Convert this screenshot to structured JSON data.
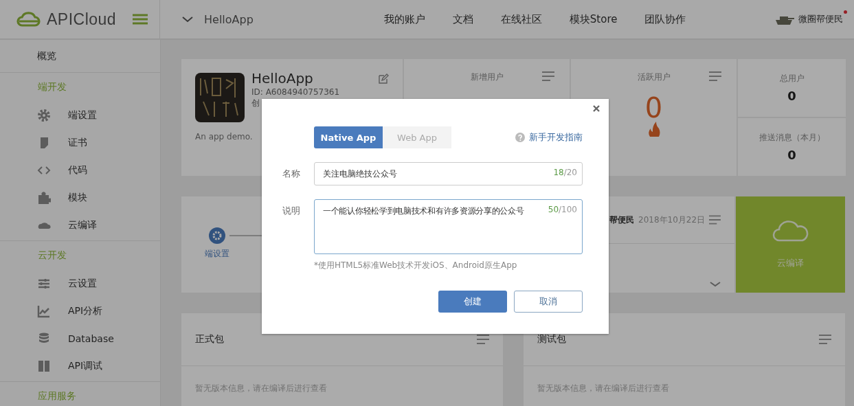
{
  "brand": {
    "name": "APICloud"
  },
  "topbar": {
    "app": "HelloApp",
    "nav": [
      "我的账户",
      "文档",
      "在线社区",
      "模块Store",
      "团队协作"
    ],
    "user": "微圈帮便民",
    "notification": true
  },
  "sidebar": {
    "overview": {
      "label": "概览",
      "selected": false
    },
    "sections": [
      {
        "title": "端开发",
        "items": [
          {
            "label": "端设置",
            "selected": false
          },
          {
            "label": "证书",
            "selected": false
          },
          {
            "label": "代码",
            "selected": false
          },
          {
            "label": "模块",
            "selected": false
          },
          {
            "label": "云编译",
            "selected": false
          }
        ]
      },
      {
        "title": "云开发",
        "items": [
          {
            "label": "云设置",
            "selected": false
          },
          {
            "label": "API分析",
            "selected": false
          },
          {
            "label": "Database",
            "selected": false
          },
          {
            "label": "API调试",
            "selected": false
          }
        ]
      },
      {
        "title": "应用服务"
      }
    ]
  },
  "app_card": {
    "name": "HelloApp",
    "id": "ID: A6084940757361",
    "created": "创",
    "description": "An app demo."
  },
  "stats": [
    {
      "title": "新增用户"
    },
    {
      "title": "活跃用户",
      "value": "0"
    }
  ],
  "totals": [
    {
      "title": "总用户",
      "value": "0"
    },
    {
      "title": "推送消息（本月）",
      "value": "0"
    }
  ],
  "steps": [
    {
      "label": "端设置"
    }
  ],
  "activity": {
    "user": "帮便民",
    "date": "2018年10月22日"
  },
  "compile_tile": {
    "label": "云编译"
  },
  "packages": [
    {
      "title": "正式包",
      "empty": "暂无版本信息，请在编译后进行查看"
    },
    {
      "title": "测试包",
      "empty": "暂无版本信息，请在编译后进行查看"
    }
  ],
  "dialog": {
    "tabs": [
      {
        "label": "Native App",
        "selected": true
      },
      {
        "label": "Web App",
        "selected": false
      }
    ],
    "help_link": "新手开发指南",
    "name": {
      "label": "名称",
      "value": "关注电脑绝技公众号",
      "count": "18",
      "limit": "/20"
    },
    "description": {
      "label": "说明",
      "value": "一个能认你轻松学到电脑技术和有许多资源分享的公众号",
      "count": "50",
      "limit": "/100"
    },
    "note": "*使用HTML5标准Web技术开发iOS、Android原生App",
    "buttons": [
      {
        "label": "创建",
        "kind": "primary"
      },
      {
        "label": "取消",
        "kind": "secondary"
      }
    ]
  }
}
